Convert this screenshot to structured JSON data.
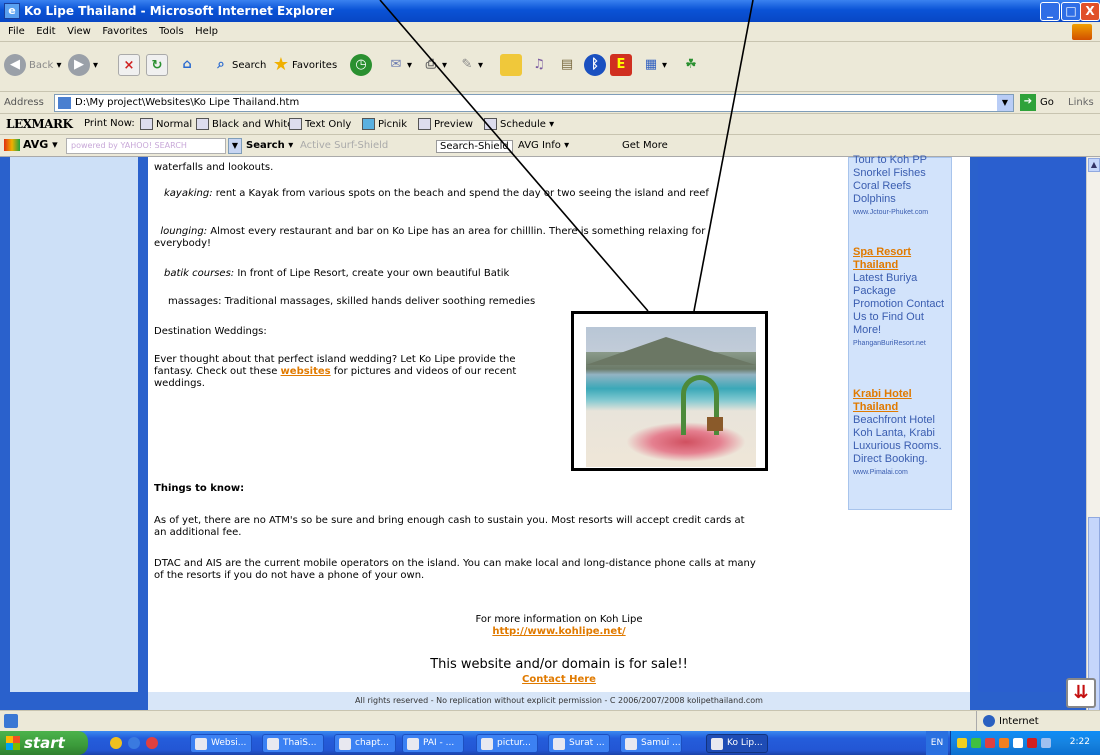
{
  "window": {
    "title": "Ko Lipe Thailand - Microsoft Internet Explorer",
    "min": "_",
    "max": "□",
    "close": "X",
    "app_icon": "ie-window-icon"
  },
  "menu": [
    "File",
    "Edit",
    "View",
    "Favorites",
    "Tools",
    "Help"
  ],
  "toolbar": {
    "back": "Back",
    "search": "Search",
    "favorites": "Favorites"
  },
  "address": {
    "label": "Address",
    "value": "D:\\My project\\Websites\\Ko Lipe Thailand.htm",
    "go": "Go",
    "links": "Links"
  },
  "lexmark": {
    "brand": "LEXMARK",
    "print_now": "Print Now:",
    "normal": "Normal",
    "bw": "Black and White",
    "text_only": "Text Only",
    "picnik": "Picnik",
    "preview": "Preview",
    "schedule": "Schedule"
  },
  "avg": {
    "brand": "AVG",
    "yahoo": "powered by YAHOO! SEARCH",
    "search": "Search",
    "active": "Active  Surf-Shield",
    "shield": "Search-Shield",
    "info": "AVG Info",
    "more": "Get More"
  },
  "content": {
    "p0": "waterfalls and lookouts.",
    "kayak_term": "kayaking:",
    "kayak": " rent a Kayak from various spots on the beach and spend the day or two seeing the island and reef",
    "lounge_term": "lounging:",
    "lounge": " Almost every restaurant and bar on Ko Lipe has an area for chilllin. There is something relaxing for everybody!",
    "batik_term": "batik courses:",
    "batik": " In front of Lipe Resort, create your own beautiful Batik",
    "massage": "massages: Traditional massages, skilled hands deliver soothing remedies",
    "weddings_title": "Destination Weddings:",
    "wed1": "Ever thought about that perfect island wedding? Let Ko Lipe provide the",
    "wed2a": "fantasy. Check out these ",
    "wed_link": "websites",
    "wed2b": " for pictures and videos of our recent",
    "wed3": "weddings.",
    "know_title": "Things to know:",
    "atm": "As of yet, there are no ATM's so be sure and bring enough cash to sustain you. Most resorts will accept credit cards at an additional fee.",
    "mobile": "DTAC and AIS are the current mobile operators on the island. You can make local and long-distance phone calls at many of the resorts if you do not have a phone of your own.",
    "moreinfo": "For more information on Koh Lipe",
    "moreinfo_link": "http://www.kohlipe.net/",
    "sale": "This website and/or domain is for sale!!",
    "contact": "Contact Here",
    "footer": "All rights reserved - No replication without explicit permission - C 2006/2007/2008 kolipethailand.com"
  },
  "ads": {
    "top_lines": [
      "Tour to Koh PP",
      "Snorkel Fishes",
      "Coral Reefs",
      "Dolphins"
    ],
    "top_url": "www.Jctour-Phuket.com",
    "ad2_title": "Spa Resort Thailand",
    "ad2_lines": [
      "Latest Buriya",
      "Package",
      "Promotion Contact",
      "Us to Find Out",
      "More!"
    ],
    "ad2_url": "PhanganBuriResort.net",
    "ad3_title": "Krabi Hotel Thailand",
    "ad3_lines": [
      "Beachfront Hotel",
      "Koh Lanta, Krabi",
      "Luxurious Rooms.",
      "Direct Booking."
    ],
    "ad3_url": "www.Pimalai.com"
  },
  "status": {
    "zone": "Internet"
  },
  "taskbar": {
    "start": "start",
    "tasks": [
      "Websi...",
      "ThaiS...",
      "chapt...",
      "PAI - ...",
      "pictur...",
      "Surat ...",
      "Samui ...",
      "Ko Lip..."
    ],
    "lang": "EN",
    "clock": "2:22"
  }
}
